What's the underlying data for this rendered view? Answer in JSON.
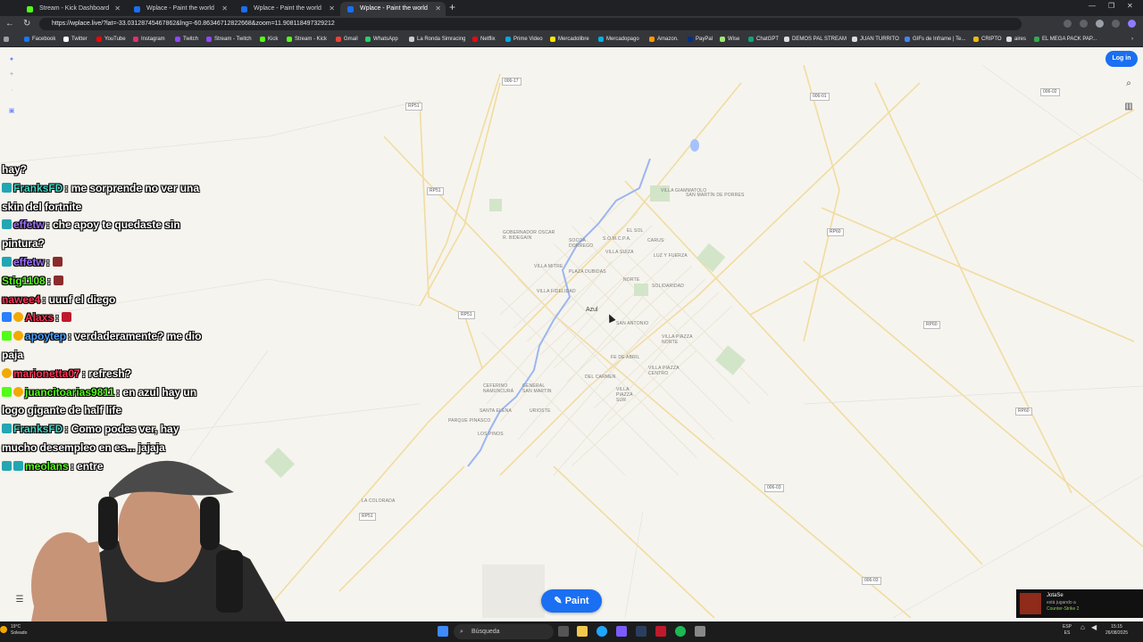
{
  "browser": {
    "tabs": [
      {
        "title": "Stream - Kick Dashboard",
        "color": "#53fc18"
      },
      {
        "title": "Wplace - Paint the world",
        "color": "#1a6ff2"
      },
      {
        "title": "Wplace - Paint the world",
        "color": "#1a6ff2"
      },
      {
        "title": "Wplace - Paint the world",
        "color": "#1a6ff2"
      }
    ],
    "url": "https://wplace.live/?lat=-33.03128745467862&lng=-60.86346712822668&zoom=11.908118497329212",
    "bookmarks": [
      {
        "label": "Facebook",
        "color": "#1877f2"
      },
      {
        "label": "Twitter",
        "color": "#ffffff"
      },
      {
        "label": "YouTube",
        "color": "#ff0000"
      },
      {
        "label": "Instagram",
        "color": "#e1306c"
      },
      {
        "label": "Twitch",
        "color": "#9146ff"
      },
      {
        "label": "Stream - Twitch",
        "color": "#9146ff"
      },
      {
        "label": "Kick",
        "color": "#53fc18"
      },
      {
        "label": "Stream - Kick",
        "color": "#53fc18"
      },
      {
        "label": "Gmail",
        "color": "#ea4335"
      },
      {
        "label": "WhatsApp",
        "color": "#25d366"
      },
      {
        "label": "La Ronda Simracing",
        "color": "#cccccc"
      },
      {
        "label": "Netflix",
        "color": "#e50914"
      },
      {
        "label": "Prime Video",
        "color": "#00a8e1"
      },
      {
        "label": "Mercadolibre",
        "color": "#ffe600"
      },
      {
        "label": "Mercadopago",
        "color": "#00b1ea"
      },
      {
        "label": "Amazon.",
        "color": "#ff9900"
      },
      {
        "label": "PayPal",
        "color": "#003087"
      },
      {
        "label": "Wise",
        "color": "#9fe870"
      },
      {
        "label": "ChatGPT",
        "color": "#10a37f"
      },
      {
        "label": "DEMOS PAL STREAM",
        "color": "#dddddd"
      },
      {
        "label": "JUAN TURRITO",
        "color": "#dddddd"
      },
      {
        "label": "GIFs de Inframe | Te...",
        "color": "#4285f4"
      },
      {
        "label": "CRIPTO",
        "color": "#f0b90b"
      },
      {
        "label": "aires",
        "color": "#dddddd"
      },
      {
        "label": "EL MEGA PACK PAP...",
        "color": "#34a853"
      }
    ]
  },
  "map": {
    "login_label": "Log in",
    "paint_label": "Paint",
    "city_label": "Azul",
    "route_shields": [
      "006-17",
      "RP51",
      "RP51",
      "RP51",
      "RP51",
      "006-01",
      "006-02",
      "RP60",
      "RP60",
      "RP60",
      "006-03",
      "006-03",
      "RP51"
    ],
    "place_labels": [
      "VILLA GIAMMATOLO",
      "SAN MARTÍN DE PORRES",
      "GOBERNADOR OSCAR R. BIDEGAIN",
      "SOCOA DORREGO",
      "S.O.M.C.P.A.",
      "EL SOL",
      "CARUS",
      "VILLA SUIZA",
      "LUZ Y FUERZA",
      "VILLA MITRE",
      "PLAZA DUBIDAS",
      "NORTE",
      "VILLA FIDELIDAD",
      "SOLIDARIDAD",
      "SAN ANTONIO",
      "VILLA PIAZZA NORTE",
      "FE DE ABRIL",
      "VILLA PIAZZA CENTRO",
      "DEL CARMEN",
      "CEFERINO NAMUNCURÁ",
      "GENERAL SAN MARTIN",
      "VILLA PIAZZA SUR",
      "SANTA ELENA",
      "URIOSTE",
      "PARQUE PINASCO",
      "LOS PINOS",
      "LA COLORADA"
    ]
  },
  "chat": [
    {
      "user": "",
      "text": "hay?",
      "color": "#ffffff",
      "badges": []
    },
    {
      "user": "FranksFD",
      "text": ": me sorprende no ver una skin del fortnite",
      "color": "#3fd6c6",
      "badges": [
        "#22a6b3"
      ]
    },
    {
      "user": "effetw",
      "text": ": che apoy te quedaste sin pintura?",
      "color": "#a070ff",
      "badges": [
        "#22a6b3"
      ]
    },
    {
      "user": "effetw",
      "text": ": ",
      "color": "#a070ff",
      "badges": [
        "#22a6b3"
      ]
    },
    {
      "user": "Stig1108",
      "text": ": ",
      "color": "#53fc18",
      "badges": []
    },
    {
      "user": "nawee4",
      "text": ": uuuf el diego",
      "color": "#ff3355",
      "badges": []
    },
    {
      "user": "Alaxs",
      "text": ": ",
      "color": "#ff3355",
      "badges": [
        "#2a7fff",
        "#f2a900"
      ]
    },
    {
      "user": "apoytep",
      "text": ": verdaderamente? me dio paja",
      "color": "#4aa3ff",
      "badges": [
        "#53fc18",
        "#f2a900"
      ]
    },
    {
      "user": "marionetta07",
      "text": ": refresh?",
      "color": "#ff3355",
      "badges": [
        "#f2a900"
      ]
    },
    {
      "user": "juancitoarias9811",
      "text": ": en azul hay un logo gigante de half life",
      "color": "#53fc18",
      "badges": [
        "#53fc18",
        "#f2a900"
      ]
    },
    {
      "user": "FranksFD",
      "text": ": Como podes ver, hay mucho desempleo en es... jajaja",
      "color": "#3fd6c6",
      "badges": [
        "#22a6b3"
      ]
    },
    {
      "user": "meolans",
      "text": ": entre",
      "color": "#53fc18",
      "badges": [
        "#22a6b3",
        "#22a6b3"
      ]
    }
  ],
  "notification": {
    "name": "JotaSe",
    "line2": "está jugando a",
    "game": "Counter-Strike 2"
  },
  "taskbar": {
    "search_placeholder": "Búsqueda",
    "lang": "ESP",
    "lang2": "ES",
    "time": "15:15",
    "date": "26/08/2025",
    "temp": "19°C",
    "weather": "Soleado"
  }
}
